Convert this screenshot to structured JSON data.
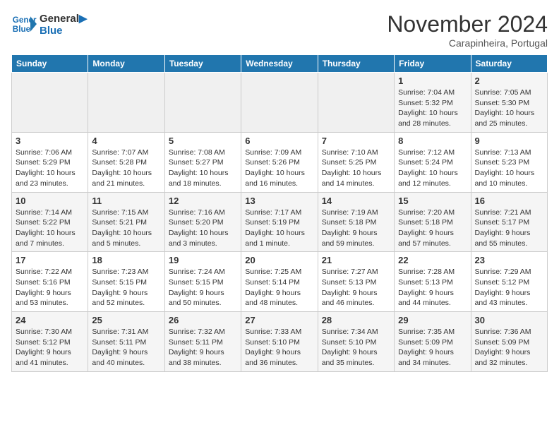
{
  "header": {
    "logo_line1": "General",
    "logo_line2": "Blue",
    "month": "November 2024",
    "location": "Carapinheira, Portugal"
  },
  "weekdays": [
    "Sunday",
    "Monday",
    "Tuesday",
    "Wednesday",
    "Thursday",
    "Friday",
    "Saturday"
  ],
  "weeks": [
    [
      {
        "day": "",
        "info": ""
      },
      {
        "day": "",
        "info": ""
      },
      {
        "day": "",
        "info": ""
      },
      {
        "day": "",
        "info": ""
      },
      {
        "day": "",
        "info": ""
      },
      {
        "day": "1",
        "info": "Sunrise: 7:04 AM\nSunset: 5:32 PM\nDaylight: 10 hours and 28 minutes."
      },
      {
        "day": "2",
        "info": "Sunrise: 7:05 AM\nSunset: 5:30 PM\nDaylight: 10 hours and 25 minutes."
      }
    ],
    [
      {
        "day": "3",
        "info": "Sunrise: 7:06 AM\nSunset: 5:29 PM\nDaylight: 10 hours and 23 minutes."
      },
      {
        "day": "4",
        "info": "Sunrise: 7:07 AM\nSunset: 5:28 PM\nDaylight: 10 hours and 21 minutes."
      },
      {
        "day": "5",
        "info": "Sunrise: 7:08 AM\nSunset: 5:27 PM\nDaylight: 10 hours and 18 minutes."
      },
      {
        "day": "6",
        "info": "Sunrise: 7:09 AM\nSunset: 5:26 PM\nDaylight: 10 hours and 16 minutes."
      },
      {
        "day": "7",
        "info": "Sunrise: 7:10 AM\nSunset: 5:25 PM\nDaylight: 10 hours and 14 minutes."
      },
      {
        "day": "8",
        "info": "Sunrise: 7:12 AM\nSunset: 5:24 PM\nDaylight: 10 hours and 12 minutes."
      },
      {
        "day": "9",
        "info": "Sunrise: 7:13 AM\nSunset: 5:23 PM\nDaylight: 10 hours and 10 minutes."
      }
    ],
    [
      {
        "day": "10",
        "info": "Sunrise: 7:14 AM\nSunset: 5:22 PM\nDaylight: 10 hours and 7 minutes."
      },
      {
        "day": "11",
        "info": "Sunrise: 7:15 AM\nSunset: 5:21 PM\nDaylight: 10 hours and 5 minutes."
      },
      {
        "day": "12",
        "info": "Sunrise: 7:16 AM\nSunset: 5:20 PM\nDaylight: 10 hours and 3 minutes."
      },
      {
        "day": "13",
        "info": "Sunrise: 7:17 AM\nSunset: 5:19 PM\nDaylight: 10 hours and 1 minute."
      },
      {
        "day": "14",
        "info": "Sunrise: 7:19 AM\nSunset: 5:18 PM\nDaylight: 9 hours and 59 minutes."
      },
      {
        "day": "15",
        "info": "Sunrise: 7:20 AM\nSunset: 5:18 PM\nDaylight: 9 hours and 57 minutes."
      },
      {
        "day": "16",
        "info": "Sunrise: 7:21 AM\nSunset: 5:17 PM\nDaylight: 9 hours and 55 minutes."
      }
    ],
    [
      {
        "day": "17",
        "info": "Sunrise: 7:22 AM\nSunset: 5:16 PM\nDaylight: 9 hours and 53 minutes."
      },
      {
        "day": "18",
        "info": "Sunrise: 7:23 AM\nSunset: 5:15 PM\nDaylight: 9 hours and 52 minutes."
      },
      {
        "day": "19",
        "info": "Sunrise: 7:24 AM\nSunset: 5:15 PM\nDaylight: 9 hours and 50 minutes."
      },
      {
        "day": "20",
        "info": "Sunrise: 7:25 AM\nSunset: 5:14 PM\nDaylight: 9 hours and 48 minutes."
      },
      {
        "day": "21",
        "info": "Sunrise: 7:27 AM\nSunset: 5:13 PM\nDaylight: 9 hours and 46 minutes."
      },
      {
        "day": "22",
        "info": "Sunrise: 7:28 AM\nSunset: 5:13 PM\nDaylight: 9 hours and 44 minutes."
      },
      {
        "day": "23",
        "info": "Sunrise: 7:29 AM\nSunset: 5:12 PM\nDaylight: 9 hours and 43 minutes."
      }
    ],
    [
      {
        "day": "24",
        "info": "Sunrise: 7:30 AM\nSunset: 5:12 PM\nDaylight: 9 hours and 41 minutes."
      },
      {
        "day": "25",
        "info": "Sunrise: 7:31 AM\nSunset: 5:11 PM\nDaylight: 9 hours and 40 minutes."
      },
      {
        "day": "26",
        "info": "Sunrise: 7:32 AM\nSunset: 5:11 PM\nDaylight: 9 hours and 38 minutes."
      },
      {
        "day": "27",
        "info": "Sunrise: 7:33 AM\nSunset: 5:10 PM\nDaylight: 9 hours and 36 minutes."
      },
      {
        "day": "28",
        "info": "Sunrise: 7:34 AM\nSunset: 5:10 PM\nDaylight: 9 hours and 35 minutes."
      },
      {
        "day": "29",
        "info": "Sunrise: 7:35 AM\nSunset: 5:09 PM\nDaylight: 9 hours and 34 minutes."
      },
      {
        "day": "30",
        "info": "Sunrise: 7:36 AM\nSunset: 5:09 PM\nDaylight: 9 hours and 32 minutes."
      }
    ]
  ]
}
